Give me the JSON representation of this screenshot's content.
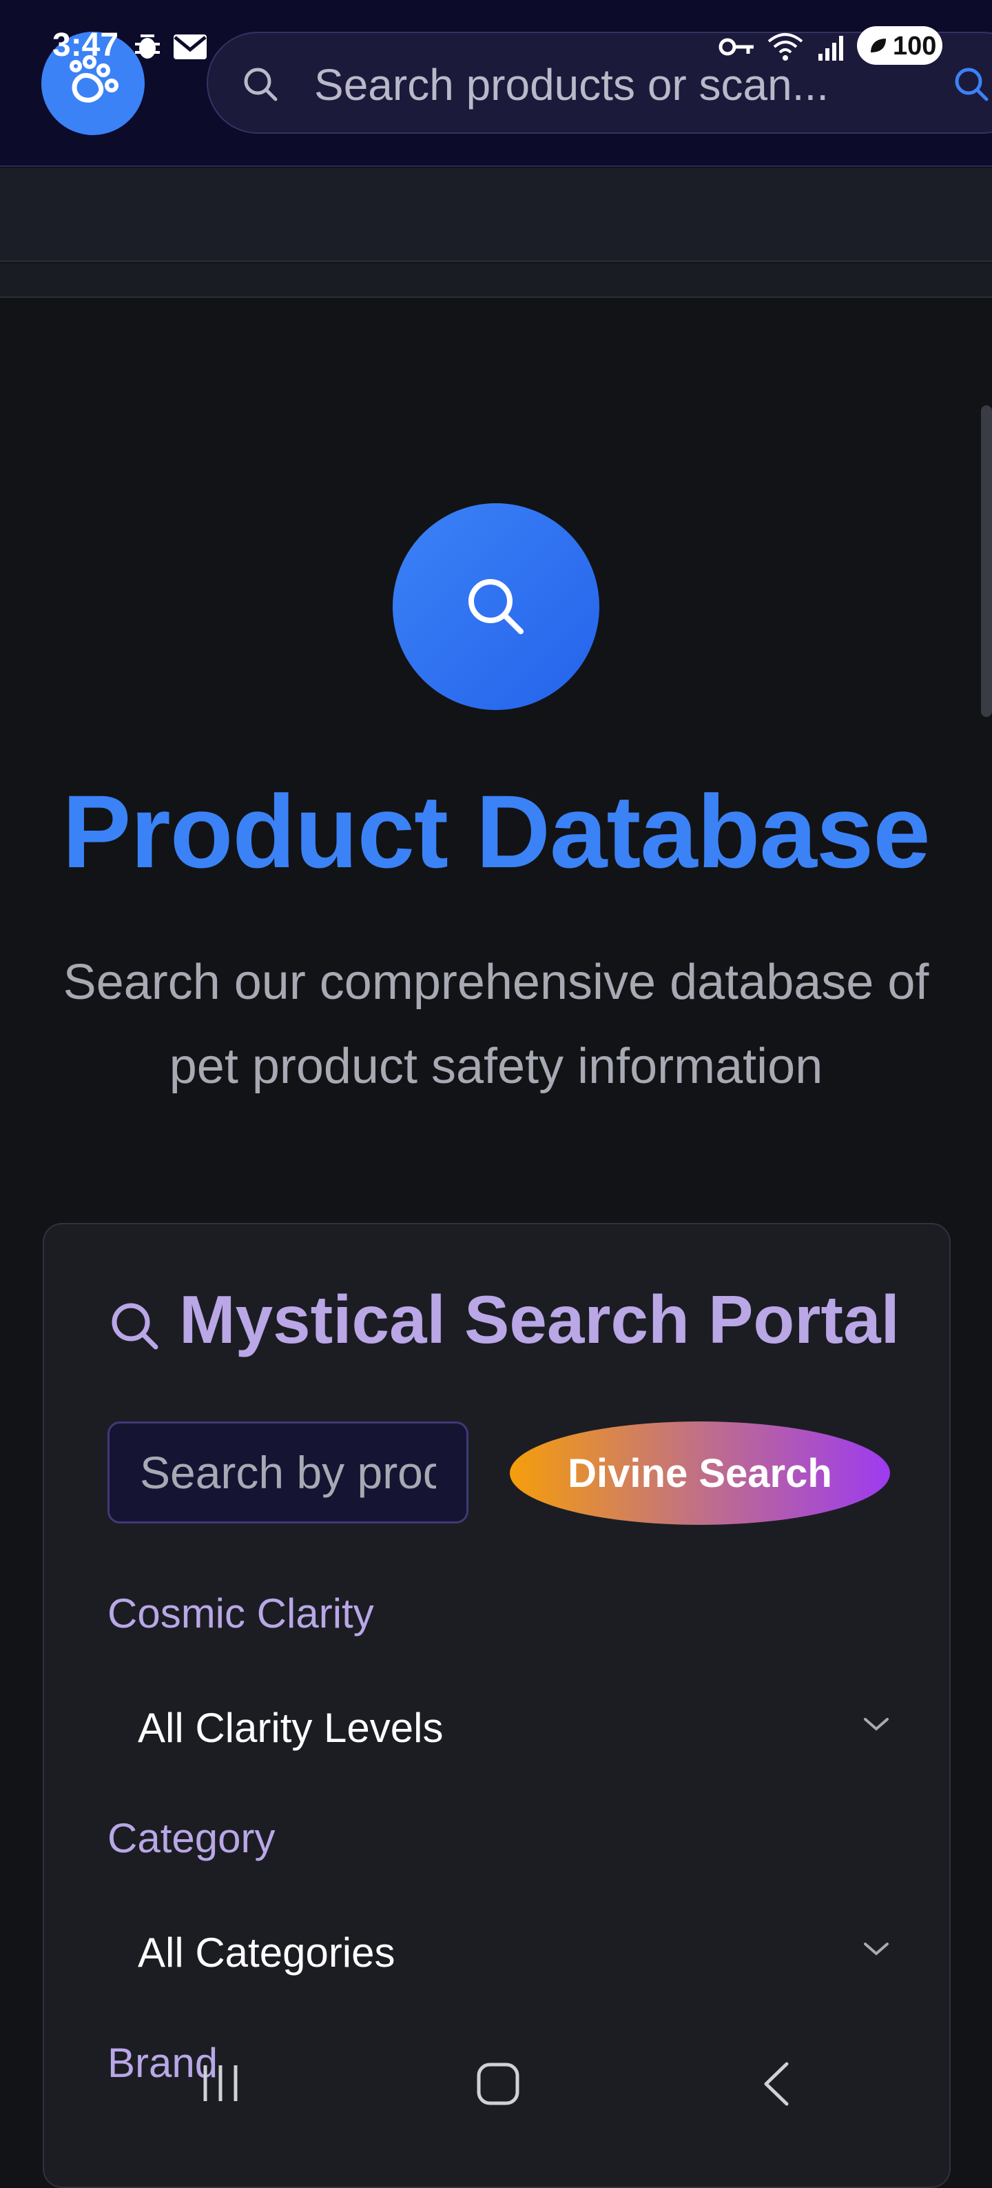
{
  "status_bar": {
    "time": "3:47",
    "battery": "100"
  },
  "header": {
    "logo_icon": "paw-icon",
    "search_placeholder": "Search products or scan..."
  },
  "hero": {
    "icon": "search-icon",
    "title": "Product Database",
    "subtitle": "Search our comprehensive database of pet product safety information"
  },
  "search_card": {
    "title": "Mystical Search Portal",
    "input_placeholder": "Search by product name, brand...",
    "search_button": "Divine Search",
    "filters": [
      {
        "label": "Cosmic Clarity",
        "value": "All Clarity Levels"
      },
      {
        "label": "Category",
        "value": "All Categories"
      },
      {
        "label": "Brand",
        "value": ""
      }
    ]
  },
  "colors": {
    "accent": "#3b82f6",
    "card_title": "#b9a7e6",
    "button_gradient_start": "#f59e0b",
    "button_gradient_end": "#9d3bf0"
  }
}
